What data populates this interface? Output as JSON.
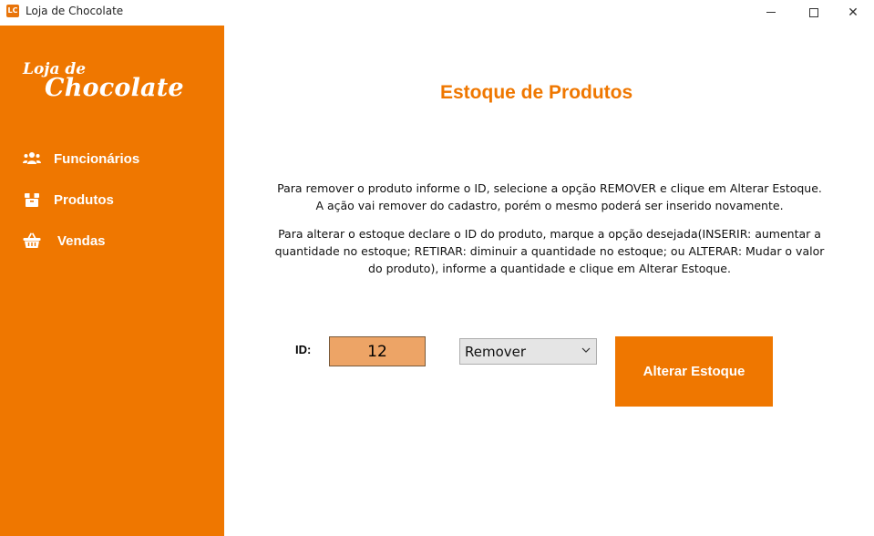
{
  "window": {
    "title": "Loja de Chocolate",
    "app_icon": "LC",
    "close_glyph": "✕"
  },
  "sidebar": {
    "logo_line1": "Loja de",
    "logo_line2": "Chocolate",
    "items": [
      {
        "label": "Funcionários",
        "icon": "users-icon"
      },
      {
        "label": "Produtos",
        "icon": "box-icon"
      },
      {
        "label": "Vendas",
        "icon": "basket-icon"
      }
    ],
    "background": "#ef7700"
  },
  "main": {
    "title": "Estoque de Produtos",
    "description_1": "Para remover o produto informe o ID, selecione a opção REMOVER e clique em Alterar Estoque. A ação vai remover do cadastro, porém o mesmo poderá ser inserido novamente.",
    "description_2": "Para alterar o estoque declare o ID do produto, marque a opção desejada(INSERIR: aumentar a quantidade no estoque; RETIRAR: diminuir a quantidade no estoque; ou ALTERAR: Mudar o valor do produto), informe a quantidade e clique em Alterar Estoque.",
    "id_label": "ID:",
    "id_value": "12",
    "option_selected": "Remover",
    "button_label": "Alterar Estoque",
    "accent": "#ef7700",
    "input_bg": "#eda466"
  }
}
